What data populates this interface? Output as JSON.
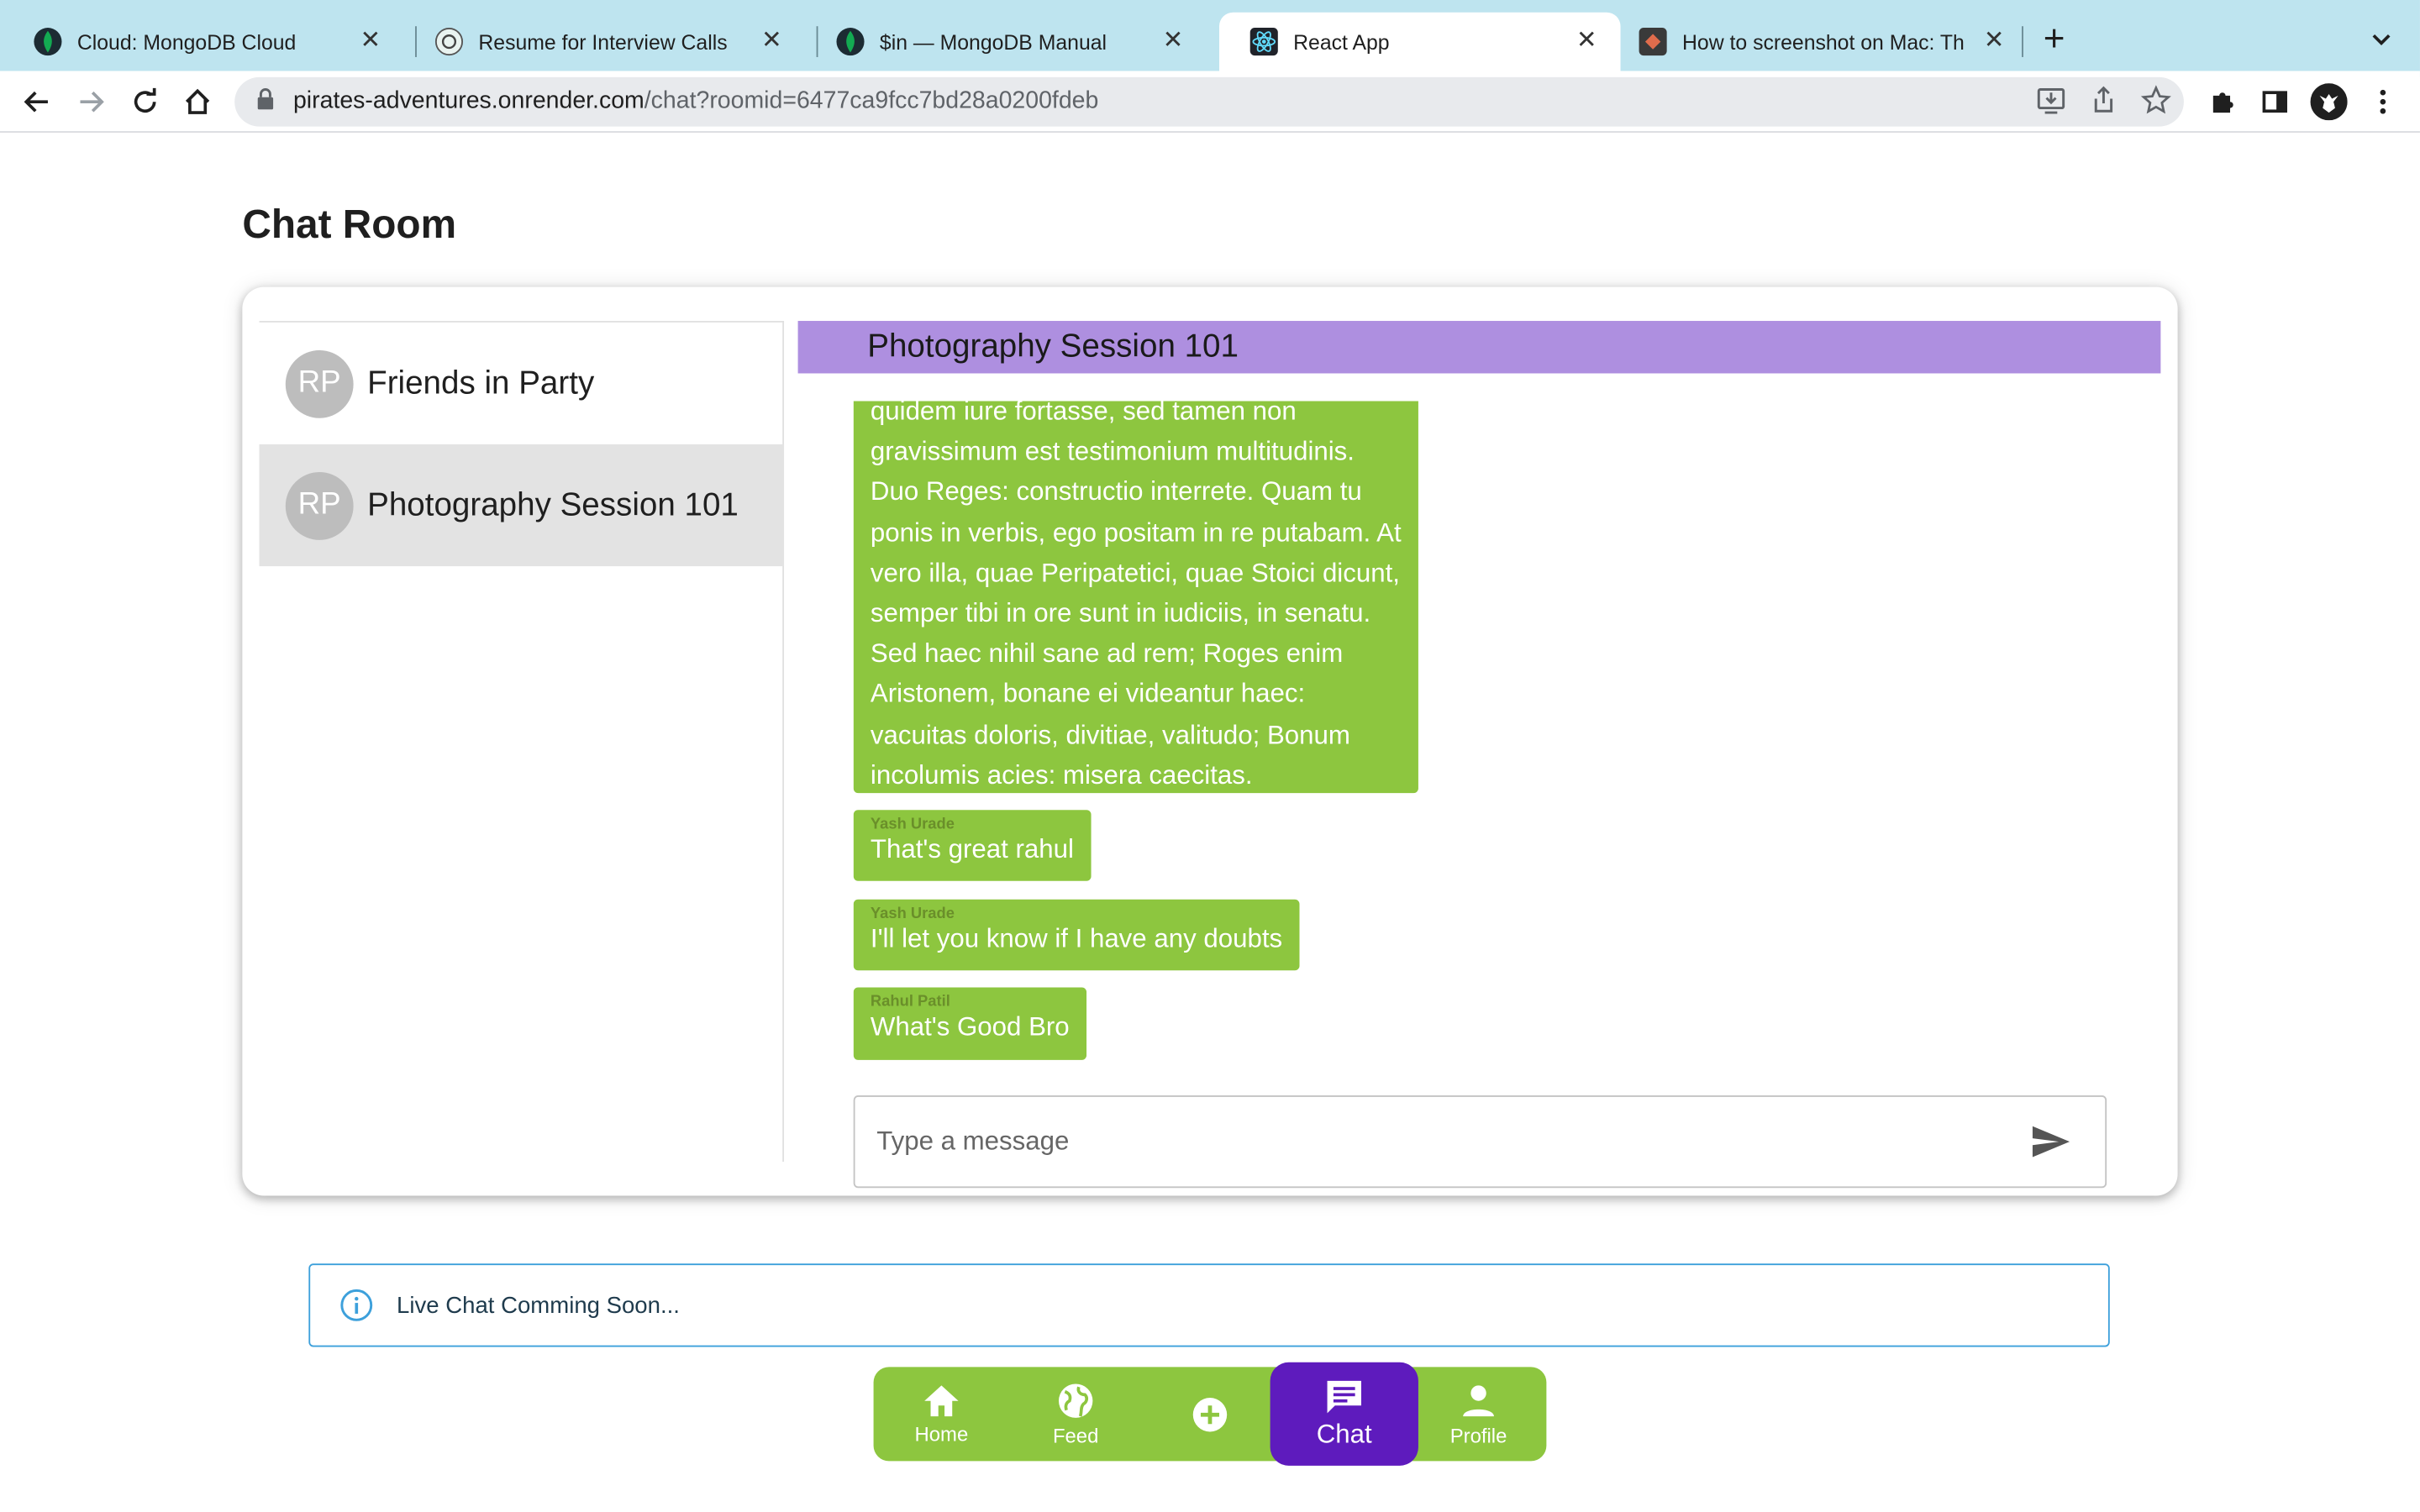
{
  "browser": {
    "tabs": [
      {
        "title": "Cloud: MongoDB Cloud",
        "favicon": "mongodb-leaf-icon"
      },
      {
        "title": "Resume for Interview Calls",
        "favicon": "chatgpt-icon"
      },
      {
        "title": "$in — MongoDB Manual",
        "favicon": "mongodb-leaf-icon"
      },
      {
        "title": "React App",
        "favicon": "react-icon",
        "active": true
      },
      {
        "title": "How to screenshot on Mac: Th",
        "favicon": "setapp-icon"
      }
    ],
    "url_host": "pirates-adventures.onrender.com",
    "url_path": "/chat?roomid=6477ca9fcc7bd28a0200fdeb"
  },
  "page": {
    "title": "Chat Room"
  },
  "rooms": [
    {
      "initials": "RP",
      "name": "Friends in Party",
      "selected": false
    },
    {
      "initials": "RP",
      "name": "Photography Session 101",
      "selected": true
    }
  ],
  "chat": {
    "header": "Photography Session 101",
    "messages": [
      {
        "sender": "",
        "text": "quidem iure fortasse, sed tamen non gravissimum est testimonium multitudinis. Duo Reges: constructio interrete. Quam tu ponis in verbis, ego positam in re putabam. At vero illa, quae Peripatetici, quae Stoici dicunt, semper tibi in ore sunt in iudiciis, in senatu. Sed haec nihil sane ad rem; Roges enim Aristonem, bonane ei videantur haec: vacuitas doloris, divitiae, valitudo; Bonum incolumis acies: misera caecitas."
      },
      {
        "sender": "Yash Urade",
        "text": "That's great rahul"
      },
      {
        "sender": "Yash Urade",
        "text": "I'll let you know if I have any doubts"
      },
      {
        "sender": "Rahul Patil",
        "text": "What's Good Bro"
      }
    ],
    "input_placeholder": "Type a message"
  },
  "alert": {
    "text": "Live Chat Comming Soon..."
  },
  "nav": {
    "home": "Home",
    "feed": "Feed",
    "chat": "Chat",
    "profile": "Profile"
  },
  "colors": {
    "accent_green": "#8dc63f",
    "header_purple": "#ae8fe0",
    "active_purple": "#5e1bbd",
    "alert_blue": "#3da0db"
  }
}
